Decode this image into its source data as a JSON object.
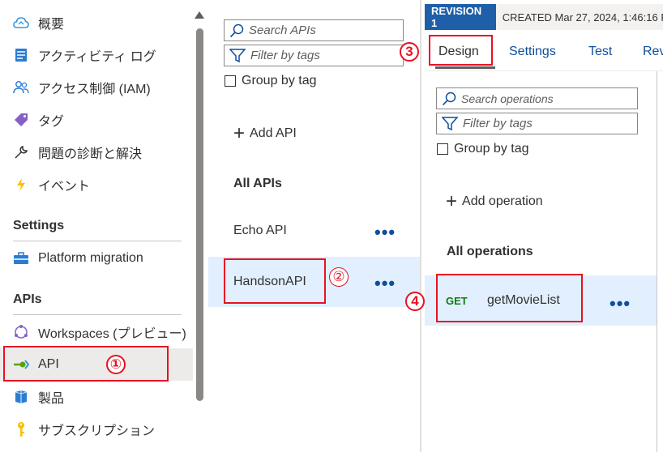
{
  "nav": {
    "items_top": [
      {
        "label": "概要",
        "icon": "cloud-icon"
      },
      {
        "label": "アクティビティ ログ",
        "icon": "activity-log-icon"
      },
      {
        "label": "アクセス制御 (IAM)",
        "icon": "people-icon"
      },
      {
        "label": "タグ",
        "icon": "tag-icon"
      },
      {
        "label": "問題の診断と解決",
        "icon": "wrench-icon"
      },
      {
        "label": "イベント",
        "icon": "lightning-icon"
      }
    ],
    "section_settings": "Settings",
    "platform_migration": "Platform migration",
    "section_apis": "APIs",
    "workspaces": "Workspaces (プレビュー)",
    "api": "API",
    "products": "製品",
    "subscriptions": "サブスクリプション"
  },
  "api_panel": {
    "search_placeholder": "Search APIs",
    "filter_placeholder": "Filter by tags",
    "group_by_tag": "Group by tag",
    "add_api": "Add API",
    "all_apis": "All APIs",
    "apis": [
      {
        "name": "Echo API",
        "more": "•••"
      },
      {
        "name": "HandsonAPI",
        "more": "•••"
      }
    ]
  },
  "ops_panel": {
    "revision_badge": "REVISION 1",
    "created": "CREATED Mar 27, 2024, 1:46:16 P",
    "tabs": [
      "Design",
      "Settings",
      "Test",
      "Rev"
    ],
    "search_placeholder": "Search operations",
    "filter_placeholder": "Filter by tags",
    "group_by_tag": "Group by tag",
    "add_operation": "Add operation",
    "all_operations": "All operations",
    "operation": {
      "method": "GET",
      "name": "getMovieList",
      "more": "•••"
    }
  },
  "annotations": {
    "step1": "①",
    "step2": "②",
    "step3": "3",
    "step4": "4"
  },
  "colors": {
    "accent_blue": "#1f5fa8",
    "link_blue": "#0e4f9c",
    "selection": "#e1efff",
    "highlight_red": "#e81123",
    "get_green": "#107c10"
  }
}
